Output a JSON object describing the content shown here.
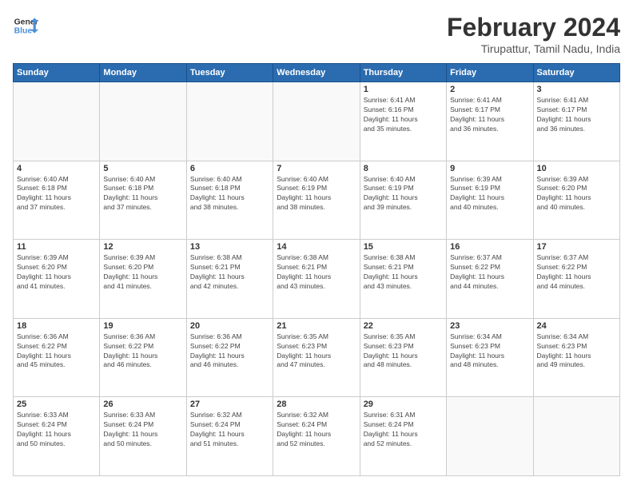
{
  "logo": {
    "line1": "General",
    "line2": "Blue"
  },
  "title": "February 2024",
  "location": "Tirupattur, Tamil Nadu, India",
  "days_header": [
    "Sunday",
    "Monday",
    "Tuesday",
    "Wednesday",
    "Thursday",
    "Friday",
    "Saturday"
  ],
  "weeks": [
    [
      {
        "num": "",
        "info": ""
      },
      {
        "num": "",
        "info": ""
      },
      {
        "num": "",
        "info": ""
      },
      {
        "num": "",
        "info": ""
      },
      {
        "num": "1",
        "info": "Sunrise: 6:41 AM\nSunset: 6:16 PM\nDaylight: 11 hours\nand 35 minutes."
      },
      {
        "num": "2",
        "info": "Sunrise: 6:41 AM\nSunset: 6:17 PM\nDaylight: 11 hours\nand 36 minutes."
      },
      {
        "num": "3",
        "info": "Sunrise: 6:41 AM\nSunset: 6:17 PM\nDaylight: 11 hours\nand 36 minutes."
      }
    ],
    [
      {
        "num": "4",
        "info": "Sunrise: 6:40 AM\nSunset: 6:18 PM\nDaylight: 11 hours\nand 37 minutes."
      },
      {
        "num": "5",
        "info": "Sunrise: 6:40 AM\nSunset: 6:18 PM\nDaylight: 11 hours\nand 37 minutes."
      },
      {
        "num": "6",
        "info": "Sunrise: 6:40 AM\nSunset: 6:18 PM\nDaylight: 11 hours\nand 38 minutes."
      },
      {
        "num": "7",
        "info": "Sunrise: 6:40 AM\nSunset: 6:19 PM\nDaylight: 11 hours\nand 38 minutes."
      },
      {
        "num": "8",
        "info": "Sunrise: 6:40 AM\nSunset: 6:19 PM\nDaylight: 11 hours\nand 39 minutes."
      },
      {
        "num": "9",
        "info": "Sunrise: 6:39 AM\nSunset: 6:19 PM\nDaylight: 11 hours\nand 40 minutes."
      },
      {
        "num": "10",
        "info": "Sunrise: 6:39 AM\nSunset: 6:20 PM\nDaylight: 11 hours\nand 40 minutes."
      }
    ],
    [
      {
        "num": "11",
        "info": "Sunrise: 6:39 AM\nSunset: 6:20 PM\nDaylight: 11 hours\nand 41 minutes."
      },
      {
        "num": "12",
        "info": "Sunrise: 6:39 AM\nSunset: 6:20 PM\nDaylight: 11 hours\nand 41 minutes."
      },
      {
        "num": "13",
        "info": "Sunrise: 6:38 AM\nSunset: 6:21 PM\nDaylight: 11 hours\nand 42 minutes."
      },
      {
        "num": "14",
        "info": "Sunrise: 6:38 AM\nSunset: 6:21 PM\nDaylight: 11 hours\nand 43 minutes."
      },
      {
        "num": "15",
        "info": "Sunrise: 6:38 AM\nSunset: 6:21 PM\nDaylight: 11 hours\nand 43 minutes."
      },
      {
        "num": "16",
        "info": "Sunrise: 6:37 AM\nSunset: 6:22 PM\nDaylight: 11 hours\nand 44 minutes."
      },
      {
        "num": "17",
        "info": "Sunrise: 6:37 AM\nSunset: 6:22 PM\nDaylight: 11 hours\nand 44 minutes."
      }
    ],
    [
      {
        "num": "18",
        "info": "Sunrise: 6:36 AM\nSunset: 6:22 PM\nDaylight: 11 hours\nand 45 minutes."
      },
      {
        "num": "19",
        "info": "Sunrise: 6:36 AM\nSunset: 6:22 PM\nDaylight: 11 hours\nand 46 minutes."
      },
      {
        "num": "20",
        "info": "Sunrise: 6:36 AM\nSunset: 6:22 PM\nDaylight: 11 hours\nand 46 minutes."
      },
      {
        "num": "21",
        "info": "Sunrise: 6:35 AM\nSunset: 6:23 PM\nDaylight: 11 hours\nand 47 minutes."
      },
      {
        "num": "22",
        "info": "Sunrise: 6:35 AM\nSunset: 6:23 PM\nDaylight: 11 hours\nand 48 minutes."
      },
      {
        "num": "23",
        "info": "Sunrise: 6:34 AM\nSunset: 6:23 PM\nDaylight: 11 hours\nand 48 minutes."
      },
      {
        "num": "24",
        "info": "Sunrise: 6:34 AM\nSunset: 6:23 PM\nDaylight: 11 hours\nand 49 minutes."
      }
    ],
    [
      {
        "num": "25",
        "info": "Sunrise: 6:33 AM\nSunset: 6:24 PM\nDaylight: 11 hours\nand 50 minutes."
      },
      {
        "num": "26",
        "info": "Sunrise: 6:33 AM\nSunset: 6:24 PM\nDaylight: 11 hours\nand 50 minutes."
      },
      {
        "num": "27",
        "info": "Sunrise: 6:32 AM\nSunset: 6:24 PM\nDaylight: 11 hours\nand 51 minutes."
      },
      {
        "num": "28",
        "info": "Sunrise: 6:32 AM\nSunset: 6:24 PM\nDaylight: 11 hours\nand 52 minutes."
      },
      {
        "num": "29",
        "info": "Sunrise: 6:31 AM\nSunset: 6:24 PM\nDaylight: 11 hours\nand 52 minutes."
      },
      {
        "num": "",
        "info": ""
      },
      {
        "num": "",
        "info": ""
      }
    ]
  ]
}
